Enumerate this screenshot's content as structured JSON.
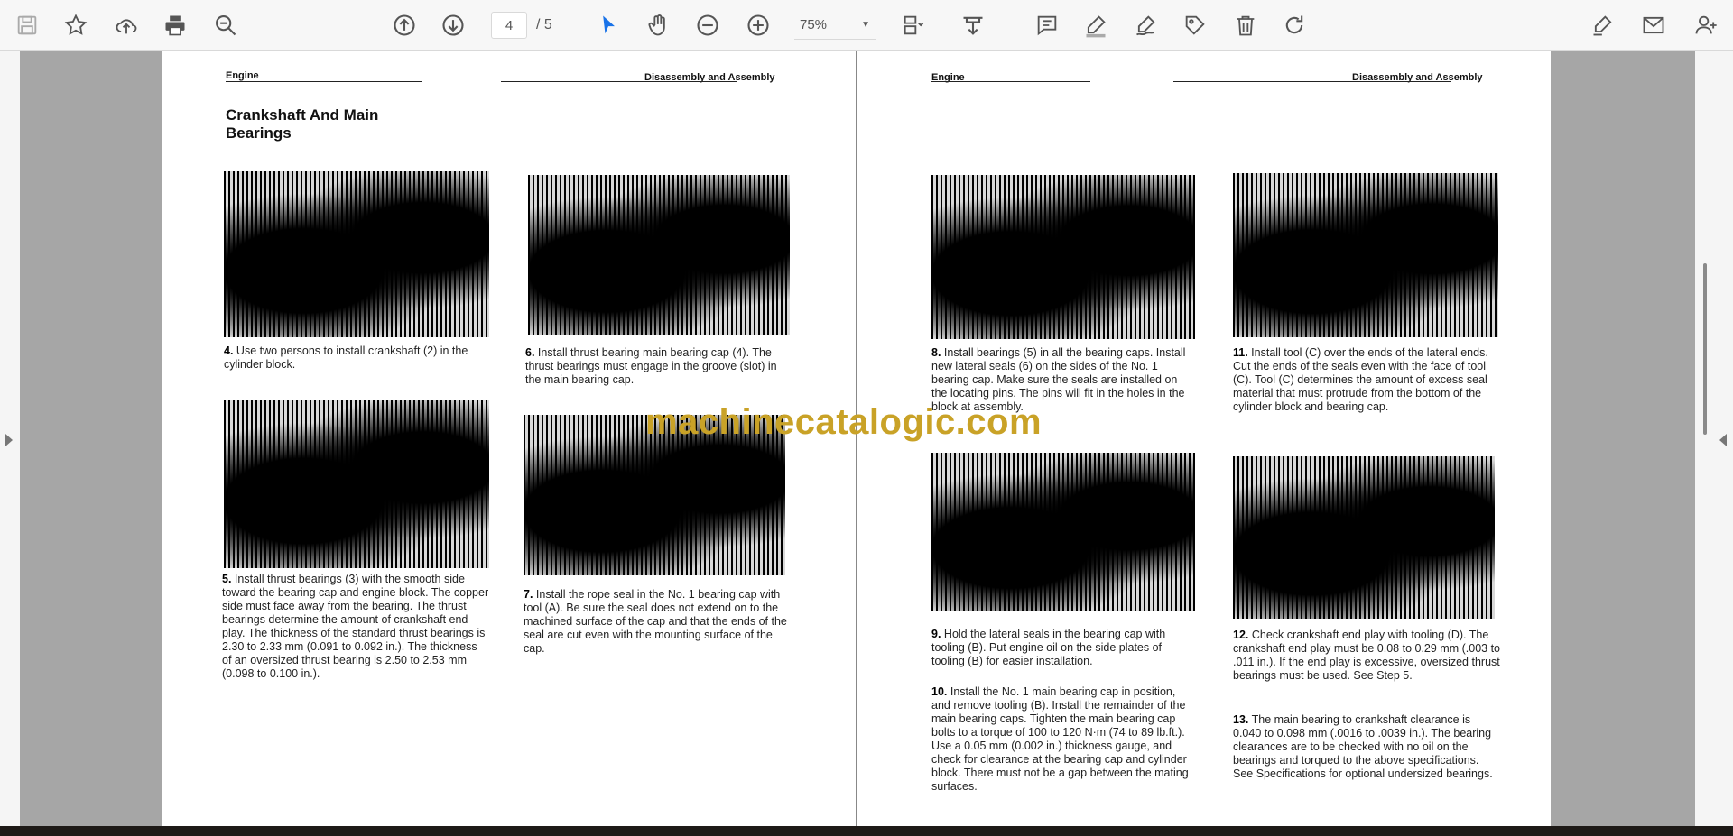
{
  "toolbar": {
    "page_current": "4",
    "page_total": "/ 5",
    "zoom": "75%",
    "icons": [
      "save-icon",
      "star-icon",
      "upload-cloud-icon",
      "print-icon",
      "search-zoom-icon",
      "arrow-up-icon",
      "arrow-down-icon",
      "select-cursor-icon",
      "hand-icon",
      "zoom-out-icon",
      "zoom-in-icon",
      "page-fit-icon",
      "download-tray-icon",
      "comment-icon",
      "highlight-pen-icon",
      "sign-pen-icon",
      "tag-edit-icon",
      "trash-icon",
      "redo-icon",
      "edit-share-icon",
      "mail-icon",
      "user-add-icon"
    ]
  },
  "watermark": "machinecatalogic.com",
  "left_page": {
    "header_left": "Engine",
    "header_right": "Disassembly and Assembly",
    "title": "Crankshaft And Main Bearings",
    "captions": [
      {
        "num": "4.",
        "text": "Use two persons to install crankshaft (2) in the cylinder block."
      },
      {
        "num": "6.",
        "text": "Install thrust bearing main bearing cap (4). The thrust bearings must engage in the groove (slot) in the main bearing cap."
      },
      {
        "num": "5.",
        "text": "Install thrust bearings (3) with the smooth side toward the bearing cap and engine block. The copper side must face away from the bearing. The thrust bearings determine the amount of crankshaft end play. The thickness of the standard thrust bearings is 2.30 to 2.33 mm (0.091 to 0.092 in.). The thickness of an oversized thrust bearing is 2.50 to 2.53 mm (0.098 to 0.100 in.)."
      },
      {
        "num": "7.",
        "text": "Install the rope seal in the No. 1 bearing cap with tool (A). Be sure the seal does not extend on to the machined surface of the cap and that the ends of the seal are cut even with the mounting surface of the cap."
      }
    ]
  },
  "right_page": {
    "header_left": "Engine",
    "header_right": "Disassembly and Assembly",
    "captions": [
      {
        "num": "8.",
        "text": "Install bearings (5) in all the bearing caps. Install new lateral seals (6) on the sides of the No. 1 bearing cap. Make sure the seals are installed on the locating pins. The pins will fit in the holes in the block at assembly."
      },
      {
        "num": "11.",
        "text": "Install tool (C) over the ends of the lateral ends. Cut the ends of the seals even with the face of tool (C). Tool (C) determines the amount of excess seal material that must protrude from the bottom of the cylinder block and bearing cap."
      },
      {
        "num": "9.",
        "text": "Hold the lateral seals in the bearing cap with tooling (B). Put engine oil on the side plates of tooling (B) for easier installation."
      },
      {
        "num": "12.",
        "text": "Check crankshaft end play with tooling (D). The crankshaft end play must be 0.08 to 0.29 mm (.003 to .011 in.). If the end play is excessive, oversized thrust bearings must be used. See Step 5."
      },
      {
        "num": "10.",
        "text": "Install the No. 1 main bearing cap in position, and remove tooling (B). Install the remainder of the main bearing caps. Tighten the main bearing cap bolts to a torque of 100 to 120 N·m (74 to 89 lb.ft.). Use a 0.05 mm (0.002 in.) thickness gauge, and check for clearance at the bearing cap and cylinder block. There must not be a gap between the mating surfaces."
      },
      {
        "num": "13.",
        "text": "The main bearing to crankshaft clearance is 0.040 to 0.098 mm (.0016 to .0039 in.). The bearing clearances are to be checked with no oil on the bearings and torqued to the above specifications. See Specifications for optional undersized bearings."
      }
    ]
  }
}
